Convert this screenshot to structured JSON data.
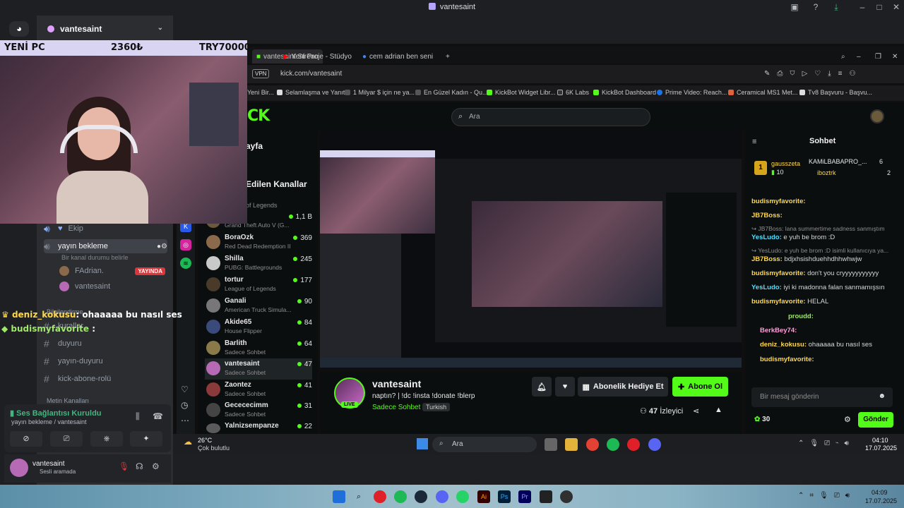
{
  "window": {
    "title": "vantesaint"
  },
  "discord": {
    "server_name": "vantesaint",
    "channels": [
      {
        "name": "Ekip",
        "icon": "heart-icon"
      },
      {
        "name": "yayın bekleme",
        "icon": "speaker-icon"
      }
    ],
    "voice_users": [
      {
        "name": "FAdrian. ",
        "badge": "YAYINDA"
      },
      {
        "name": "vantesaint"
      }
    ],
    "voice_note": "Bir kanal durumu belirle",
    "category_1": "Bilgilendirme",
    "text_channels": [
      "kurallar",
      "duyuru",
      "yayın-duyuru",
      "kick-abone-rolü"
    ],
    "category_2": "Metin Kanalları",
    "voice_status": "Ses Bağlantısı Kuruldu",
    "voice_location": "yayın bekleme / vantesaint",
    "user": {
      "name": "vantesaint",
      "status": "Sesli aramada"
    }
  },
  "cam_bar": {
    "left": "YENİ PC",
    "mid": "2360₺",
    "right": "TRY70000"
  },
  "overlay_chat": [
    {
      "user": "deniz_kokusu",
      "text": ": ohaaaaa bu nasıl ses",
      "color": "#ffd84a"
    },
    {
      "user": "budismyfavorite",
      "text": " :",
      "color": "#9fe86a"
    }
  ],
  "browser": {
    "tabs": [
      {
        "label": "vantesaint Stream - Watch"
      },
      {
        "label": "Yeni Proje - Stüdyo"
      },
      {
        "label": "cem adrian ben seni çok se..."
      }
    ],
    "vpn": "VPN",
    "url": "kick.com/vantesaint",
    "bookmarks": [
      "Yeni Bir...",
      "Selamlaşma ve Yanıt",
      "1 Milyar $ için ne ya...",
      "En Güzel Kadın - Qu...",
      "KickBot Widget Libr...",
      "6K Labs",
      "KickBot Dashboard",
      "Prime Video: Reach...",
      "Ceramical MS1 Met...",
      "Tv8 Başvuru - Başvu..."
    ]
  },
  "kick": {
    "search_placeholder": "Ara",
    "sidebar_heading_1": "ayfa",
    "sidebar_heading_2": "Edilen Kanallar",
    "top_game": "of Legends",
    "streams": [
      {
        "name": "s",
        "game": "Grand Theft Auto V (G...",
        "viewers": "1,1 B",
        "color": "#6a5a3a"
      },
      {
        "name": "BoraOzk",
        "game": "Red Dead Redemption II",
        "viewers": "369",
        "color": "#8a6a4a"
      },
      {
        "name": "Shilla",
        "game": "PUBG: Battlegrounds",
        "viewers": "245",
        "color": "#c9c9c9"
      },
      {
        "name": "tortur",
        "game": "League of Legends",
        "viewers": "177",
        "color": "#4a3a2a"
      },
      {
        "name": "Ganali",
        "game": "American Truck Simula...",
        "viewers": "90",
        "color": "#777"
      },
      {
        "name": "Akide65",
        "game": "House Flipper",
        "viewers": "84",
        "color": "#3a4a7a"
      },
      {
        "name": "Barlith",
        "game": "Sadece Sohbet",
        "viewers": "64",
        "color": "#8a7a4a"
      },
      {
        "name": "vantesaint",
        "game": "Sadece Sohbet",
        "viewers": "47",
        "color": "#b66ab6"
      },
      {
        "name": "Zaontez",
        "game": "Sadece Sohbet",
        "viewers": "41",
        "color": "#8a3a3a"
      },
      {
        "name": "Gecececimm",
        "game": "Sadece Sohbet",
        "viewers": "31",
        "color": "#444"
      },
      {
        "name": "Yalnizsempanze",
        "game": "",
        "viewers": "22",
        "color": "#5a5a5a"
      }
    ],
    "channel": {
      "name": "vantesaint",
      "title": "naptın? | !dc !insta !donate !blerp",
      "category": "Sadece Sohbet",
      "tag": "Turkish",
      "live": "LIVE",
      "viewers": "47",
      "viewers_label": "İzleyici"
    },
    "buttons": {
      "gift": "Abonelik Hediye Et",
      "subscribe": "Abone Ol"
    },
    "chat": {
      "title": "Sohbet",
      "top_gifters": [
        {
          "name": "gausszeta",
          "count": "10"
        },
        {
          "name": "KAMiLBABAPRO_...",
          "count": "6"
        },
        {
          "name": "iboztrk",
          "count": "2"
        }
      ],
      "messages": [
        {
          "user": "budismyfavorite:",
          "text": "",
          "color": "#ffd84a"
        },
        {
          "user": "JB7Boss:",
          "text": "",
          "color": "#ffd84a"
        },
        {
          "user": "",
          "text": "↪ JB7Boss: lana summertime sadness sanmıştım",
          "color": "#8d8d8d"
        },
        {
          "user": "YesLudo:",
          "text": " e yuh be brom :D",
          "color": "#4fe0ff"
        },
        {
          "user": "",
          "text": "↪ YesLudo: e yuh be brom :D isimli kullanıcıya ya...",
          "color": "#8d8d8d"
        },
        {
          "user": "JB7Boss:",
          "text": " bdjxhsishduehhdhhwhwjw",
          "color": "#ffd84a"
        },
        {
          "user": "budismyfavorite:",
          "text": " don't you cryyyyyyyyyyy",
          "color": "#ffd84a"
        },
        {
          "user": "YesLudo:",
          "text": " iyi ki madonna falan sanmamışsın",
          "color": "#4fe0ff"
        },
        {
          "user": "budismyfavorite:",
          "text": " HELAL",
          "color": "#ffd84a"
        },
        {
          "user": "proudd:",
          "text": "",
          "color": "#9fe86a"
        },
        {
          "user": "BerkBey74:",
          "text": "",
          "color": "#ff9ed8"
        },
        {
          "user": "deniz_kokusu:",
          "text": " ohaaaaa bu nasıl ses",
          "color": "#ffd84a"
        },
        {
          "user": "budismyfavorite:",
          "text": "",
          "color": "#ffd84a"
        }
      ],
      "input_placeholder": "Bir mesaj gönderin",
      "points": "30",
      "send": "Gönder"
    }
  },
  "inner_taskbar": {
    "weather_temp": "26°C",
    "weather_desc": "Çok bulutlu",
    "search": "Ara",
    "time": "04:10",
    "date": "17.07.2025"
  },
  "outer_taskbar": {
    "time": "04:09",
    "date": "17.07.2025"
  }
}
